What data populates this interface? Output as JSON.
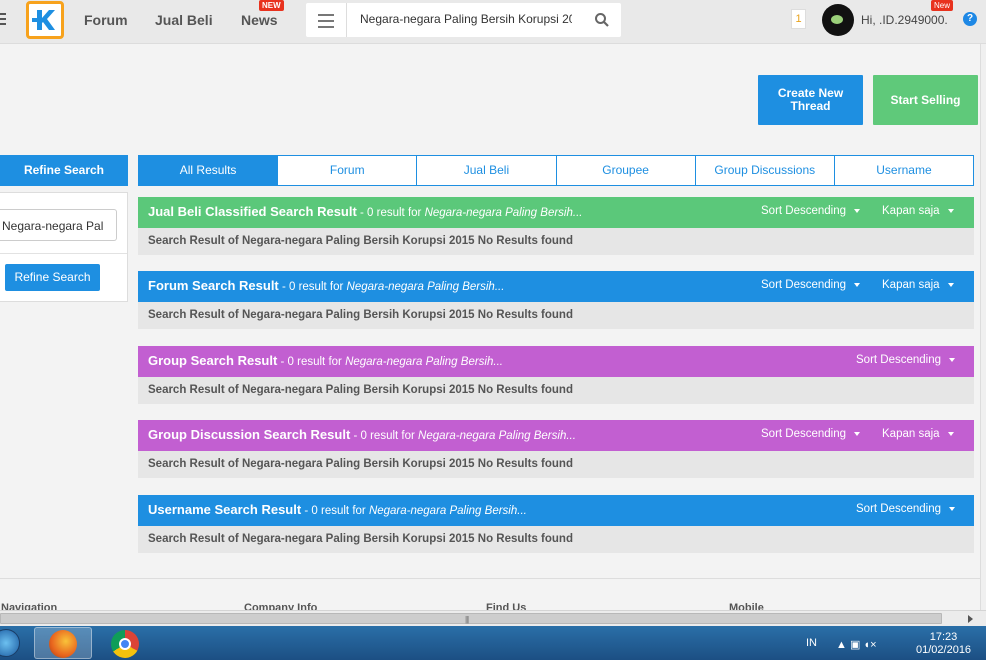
{
  "header": {
    "nav": [
      "Forum",
      "Jual Beli",
      "News"
    ],
    "news_badge": "NEW",
    "search_value": "Negara-negara Paling Bersih Korupsi 20",
    "notification_count": "1",
    "user_name": "Hi, .ID.2949000.",
    "user_badge": "New",
    "help": "?"
  },
  "actions": {
    "create_thread": "Create New Thread",
    "start_selling": "Start Selling"
  },
  "sidebar": {
    "heading": "Refine Search",
    "input_value": "Negara-negara Pal",
    "button": "Refine Search"
  },
  "tabs": [
    "All Results",
    "Forum",
    "Jual Beli",
    "Groupee",
    "Group Discussions",
    "Username"
  ],
  "results": [
    {
      "title": "Jual Beli Classified Search Result",
      "meta": " - 0 result for ",
      "query": "Negara-negara Paling Bersih...",
      "sort": "Sort Descending",
      "time": "Kapan saja",
      "body": "Search Result of Negara-negara Paling Bersih Korupsi 2015 No Results found"
    },
    {
      "title": "Forum Search Result",
      "meta": " - 0 result for ",
      "query": "Negara-negara Paling Bersih...",
      "sort": "Sort Descending",
      "time": "Kapan saja",
      "body": "Search Result of Negara-negara Paling Bersih Korupsi 2015 No Results found"
    },
    {
      "title": "Group Search Result",
      "meta": " - 0 result for ",
      "query": "Negara-negara Paling Bersih...",
      "sort": "Sort Descending",
      "body": "Search Result of Negara-negara Paling Bersih Korupsi 2015 No Results found"
    },
    {
      "title": "Group Discussion Search Result",
      "meta": " - 0 result for ",
      "query": "Negara-negara Paling Bersih...",
      "sort": "Sort Descending",
      "time": "Kapan saja",
      "body": "Search Result of Negara-negara Paling Bersih Korupsi 2015 No Results found"
    },
    {
      "title": "Username Search Result",
      "meta": " - 0 result for ",
      "query": "Negara-negara Paling Bersih...",
      "sort": "Sort Descending",
      "body": "Search Result of Negara-negara Paling Bersih Korupsi 2015 No Results found"
    }
  ],
  "footer": [
    "Navigation",
    "Company Info",
    "Find Us",
    "Mobile"
  ],
  "taskbar": {
    "lang": "IN",
    "time": "17:23",
    "date": "01/02/2016"
  },
  "colors": {
    "blue": "#1e8fe1",
    "green": "#5bc87a",
    "purple": "#c25fd1",
    "logo_orange": "#f7a21c"
  }
}
